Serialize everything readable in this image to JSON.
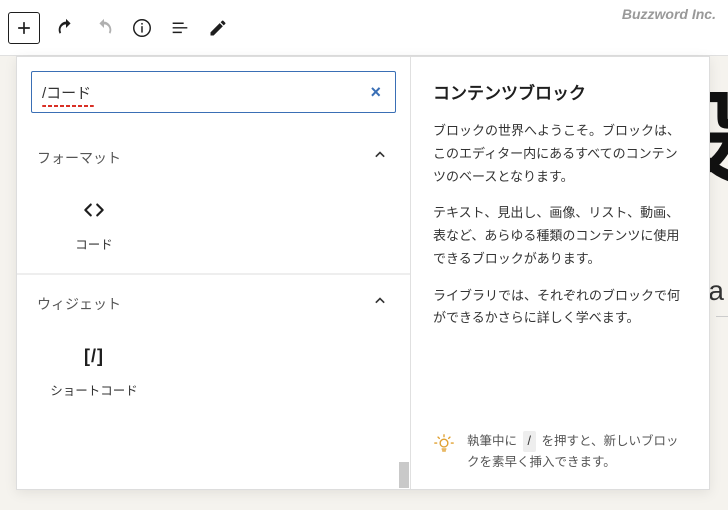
{
  "brand": "Buzzword Inc.",
  "toolbar": {
    "add": "add",
    "undo": "undo",
    "redo": "redo",
    "info": "info",
    "outline": "outline",
    "edit": "edit"
  },
  "background": {
    "heading_fragment": "設",
    "a_fragment": "a"
  },
  "inserter": {
    "search_value": "/コード",
    "search_clear": "×",
    "sections": [
      {
        "key": "format",
        "title": "フォーマット",
        "expanded": true,
        "items": [
          {
            "icon": "code-icon",
            "label": "コード"
          }
        ]
      },
      {
        "key": "widgets",
        "title": "ウィジェット",
        "expanded": true,
        "items": [
          {
            "icon": "shortcode-icon",
            "label": "ショートコード"
          }
        ]
      }
    ]
  },
  "preview": {
    "title": "コンテンツブロック",
    "paragraphs": [
      "ブロックの世界へようこそ。ブロックは、このエディター内にあるすべてのコンテンツのベースとなります。",
      "テキスト、見出し、画像、リスト、動画、表など、あらゆる種類のコンテンツに使用できるブロックがあります。",
      "ライブラリでは、それぞれのブロックで何ができるかさらに詳しく学べます。"
    ],
    "tip_prefix": "執筆中に",
    "tip_key": "/",
    "tip_suffix": "を押すと、新しいブロックを素早く挿入できます。"
  }
}
